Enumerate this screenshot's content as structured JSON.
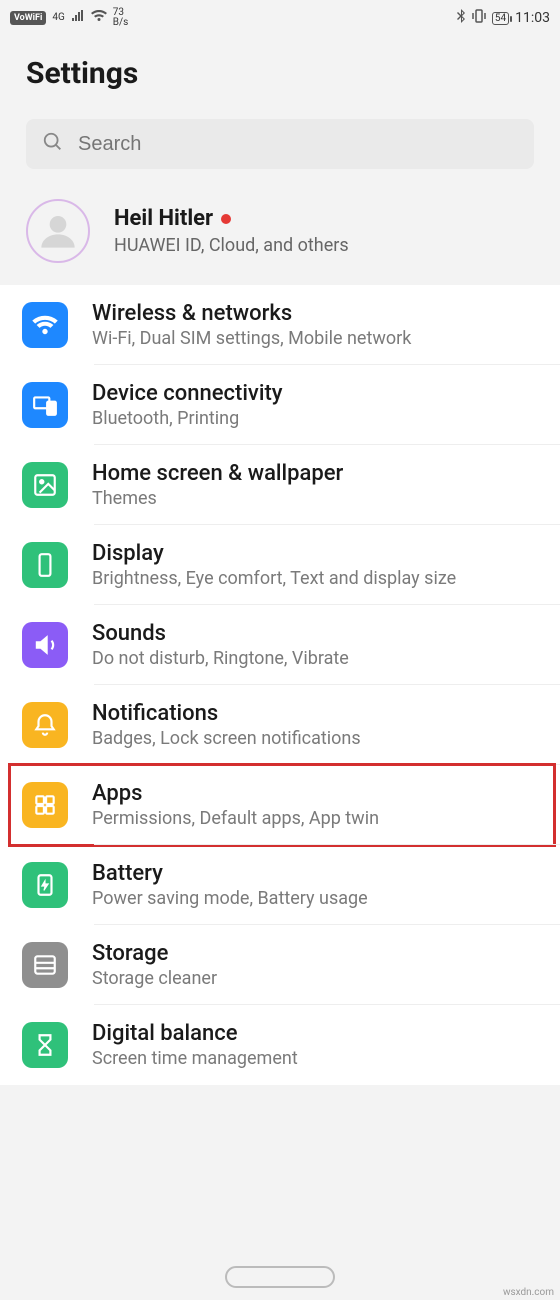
{
  "statusbar": {
    "vowifi": "VoWiFi",
    "net_gen": "4G",
    "speed_top": "73",
    "speed_bottom": "B/s",
    "battery": "54",
    "time": "11:03"
  },
  "page_title": "Settings",
  "search": {
    "placeholder": "Search"
  },
  "profile": {
    "name": "Heil Hitler",
    "sub": "HUAWEI ID, Cloud, and others"
  },
  "items": [
    {
      "id": "wireless",
      "title": "Wireless & networks",
      "sub": "Wi-Fi, Dual SIM settings, Mobile network",
      "color": "#1e88ff",
      "icon": "wifi"
    },
    {
      "id": "device-conn",
      "title": "Device connectivity",
      "sub": "Bluetooth, Printing",
      "color": "#1e88ff",
      "icon": "devices"
    },
    {
      "id": "home-wall",
      "title": "Home screen & wallpaper",
      "sub": "Themes",
      "color": "#2fc17a",
      "icon": "image"
    },
    {
      "id": "display",
      "title": "Display",
      "sub": "Brightness, Eye comfort, Text and display size",
      "color": "#2fc17a",
      "icon": "display"
    },
    {
      "id": "sounds",
      "title": "Sounds",
      "sub": "Do not disturb, Ringtone, Vibrate",
      "color": "#8b5cf6",
      "icon": "volume"
    },
    {
      "id": "notifications",
      "title": "Notifications",
      "sub": "Badges, Lock screen notifications",
      "color": "#f9b521",
      "icon": "bell"
    },
    {
      "id": "apps",
      "title": "Apps",
      "sub": "Permissions, Default apps, App twin",
      "color": "#f9b521",
      "icon": "grid",
      "highlighted": true
    },
    {
      "id": "battery",
      "title": "Battery",
      "sub": "Power saving mode, Battery usage",
      "color": "#2fc17a",
      "icon": "battery"
    },
    {
      "id": "storage",
      "title": "Storage",
      "sub": "Storage cleaner",
      "color": "#8f8f8f",
      "icon": "storage"
    },
    {
      "id": "digital",
      "title": "Digital balance",
      "sub": "Screen time management",
      "color": "#2fc17a",
      "icon": "hourglass"
    }
  ],
  "watermark": "wsxdn.com"
}
